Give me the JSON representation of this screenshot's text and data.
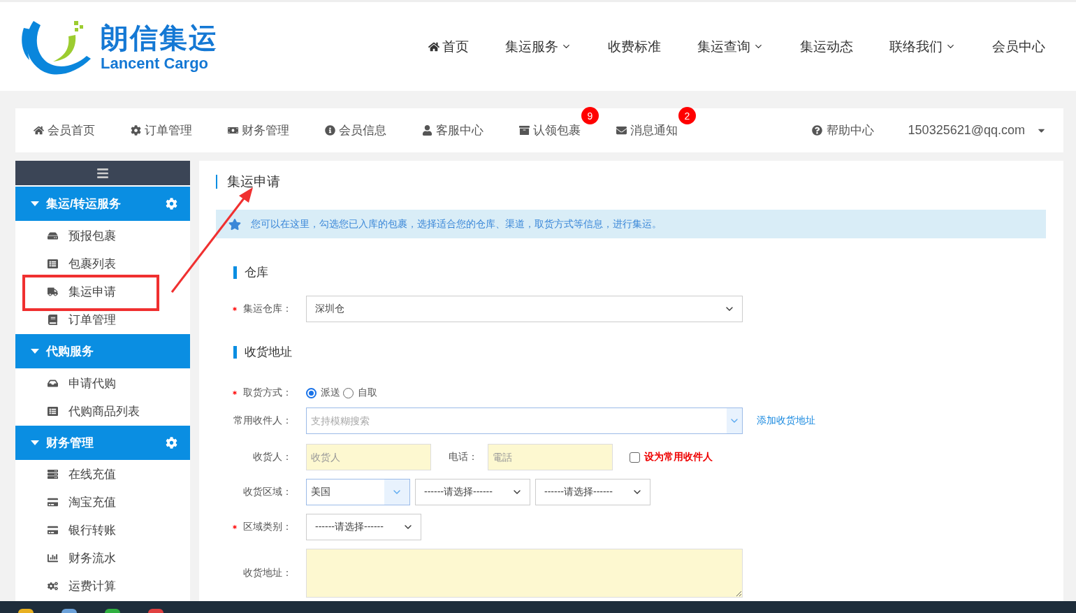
{
  "logo": {
    "name": "朗信集运",
    "subtitle": "Lancent Cargo"
  },
  "nav": [
    {
      "label": "首页",
      "dropdown": false
    },
    {
      "label": "集运服务",
      "dropdown": true
    },
    {
      "label": "收费标准",
      "dropdown": false
    },
    {
      "label": "集运查询",
      "dropdown": true
    },
    {
      "label": "集运动态",
      "dropdown": false
    },
    {
      "label": "联络我们",
      "dropdown": true
    },
    {
      "label": "会员中心",
      "dropdown": false
    }
  ],
  "member_bar": {
    "items": [
      {
        "label": "会员首页"
      },
      {
        "label": "订单管理"
      },
      {
        "label": "财务管理"
      },
      {
        "label": "会员信息"
      },
      {
        "label": "客服中心"
      },
      {
        "label": "认领包裹",
        "badge": "9"
      },
      {
        "label": "消息通知",
        "badge": "2"
      }
    ],
    "help": {
      "label": "帮助中心"
    },
    "account": "150325621@qq.com"
  },
  "sidebar": {
    "groups": [
      {
        "title": "集运/转运服务",
        "settings": true,
        "expanded": true,
        "items": [
          {
            "label": "预报包裹",
            "annotated": false
          },
          {
            "label": "包裹列表",
            "annotated": false
          },
          {
            "label": "集运申请",
            "annotated": true
          },
          {
            "label": "订单管理",
            "annotated": false
          }
        ]
      },
      {
        "title": "代购服务",
        "settings": false,
        "expanded": true,
        "items": [
          {
            "label": "申请代购",
            "annotated": false
          },
          {
            "label": "代购商品列表",
            "annotated": false
          }
        ]
      },
      {
        "title": "财务管理",
        "settings": true,
        "expanded": true,
        "items": [
          {
            "label": "在线充值",
            "annotated": false
          },
          {
            "label": "淘宝充值",
            "annotated": false
          },
          {
            "label": "银行转账",
            "annotated": false
          },
          {
            "label": "财务流水",
            "annotated": false
          },
          {
            "label": "运费计算",
            "annotated": false
          }
        ]
      }
    ]
  },
  "page": {
    "title": "集运申请",
    "notice": "您可以在这里，勾选您已入库的包裹，选择适合您的仓库、渠道，取货方式等信息，进行集运。",
    "warehouse_section": {
      "title": "仓库",
      "warehouse": {
        "label": "集运仓库：",
        "required": true,
        "value": "深圳仓"
      }
    },
    "address_section": {
      "title": "收货地址",
      "delivery": {
        "label": "取货方式：",
        "required": true,
        "options": [
          {
            "label": "派送",
            "selected": true
          },
          {
            "label": "自取",
            "selected": false
          }
        ]
      },
      "contact": {
        "label": "常用收件人：",
        "required": false,
        "placeholder": "支持模糊搜索",
        "link": "添加收货地址"
      },
      "receiver": {
        "label": "收货人：",
        "required": false,
        "placeholder": "收货人"
      },
      "phone": {
        "label": "电话：",
        "placeholder": "電話"
      },
      "save_contact": {
        "label": "设为常用收件人",
        "checked": false
      },
      "region": {
        "label": "收货区域：",
        "required": false,
        "country": "美国",
        "selects": [
          "------请选择------",
          "------请选择------"
        ]
      },
      "region_type": {
        "label": "区域类别：",
        "required": true,
        "value": "------请选择------"
      },
      "address": {
        "label": "收货地址：",
        "required": false
      }
    }
  }
}
